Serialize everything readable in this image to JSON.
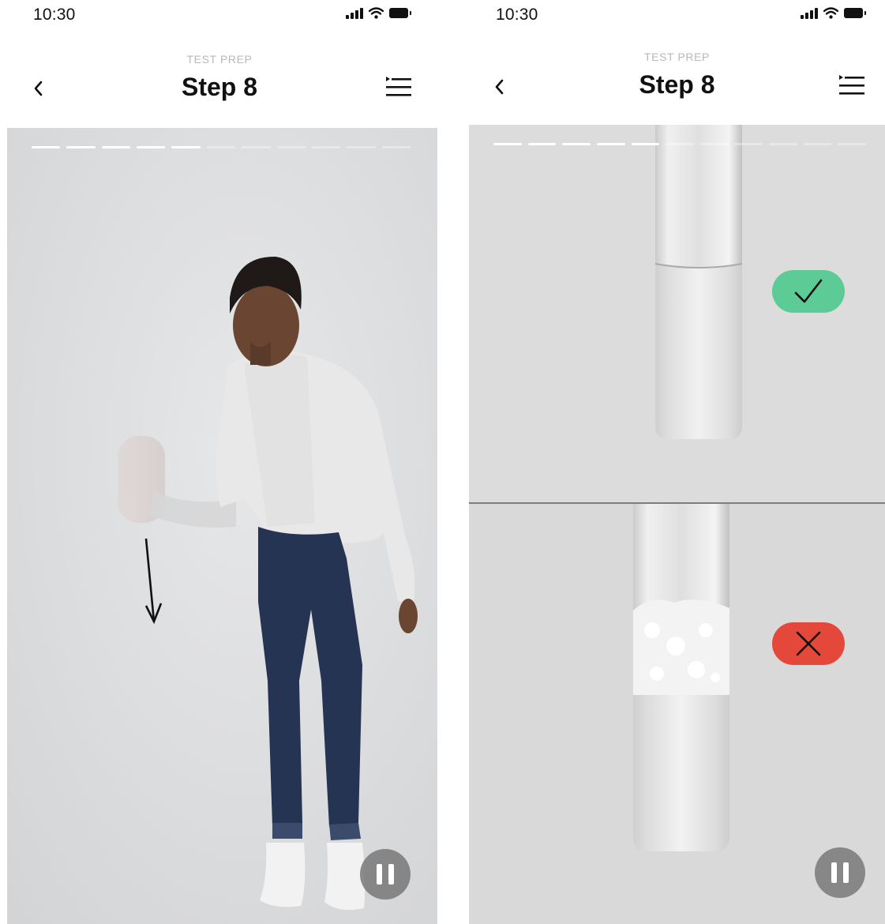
{
  "screens": [
    {
      "status": {
        "time": "10:30"
      },
      "header": {
        "overline": "TEST PREP",
        "title": "Step 8"
      },
      "progress": {
        "total": 11,
        "completed": 5
      }
    },
    {
      "status": {
        "time": "10:30"
      },
      "header": {
        "overline": "TEST PREP",
        "title": "Step 8"
      },
      "progress": {
        "total": 11,
        "completed": 5
      },
      "indicators": [
        "correct-check-icon",
        "incorrect-x-icon"
      ]
    }
  ],
  "colors": {
    "correct": "#5ccb95",
    "incorrect": "#e4483a",
    "media_background": "#dedfe1",
    "overline": "#b8b8b8"
  }
}
